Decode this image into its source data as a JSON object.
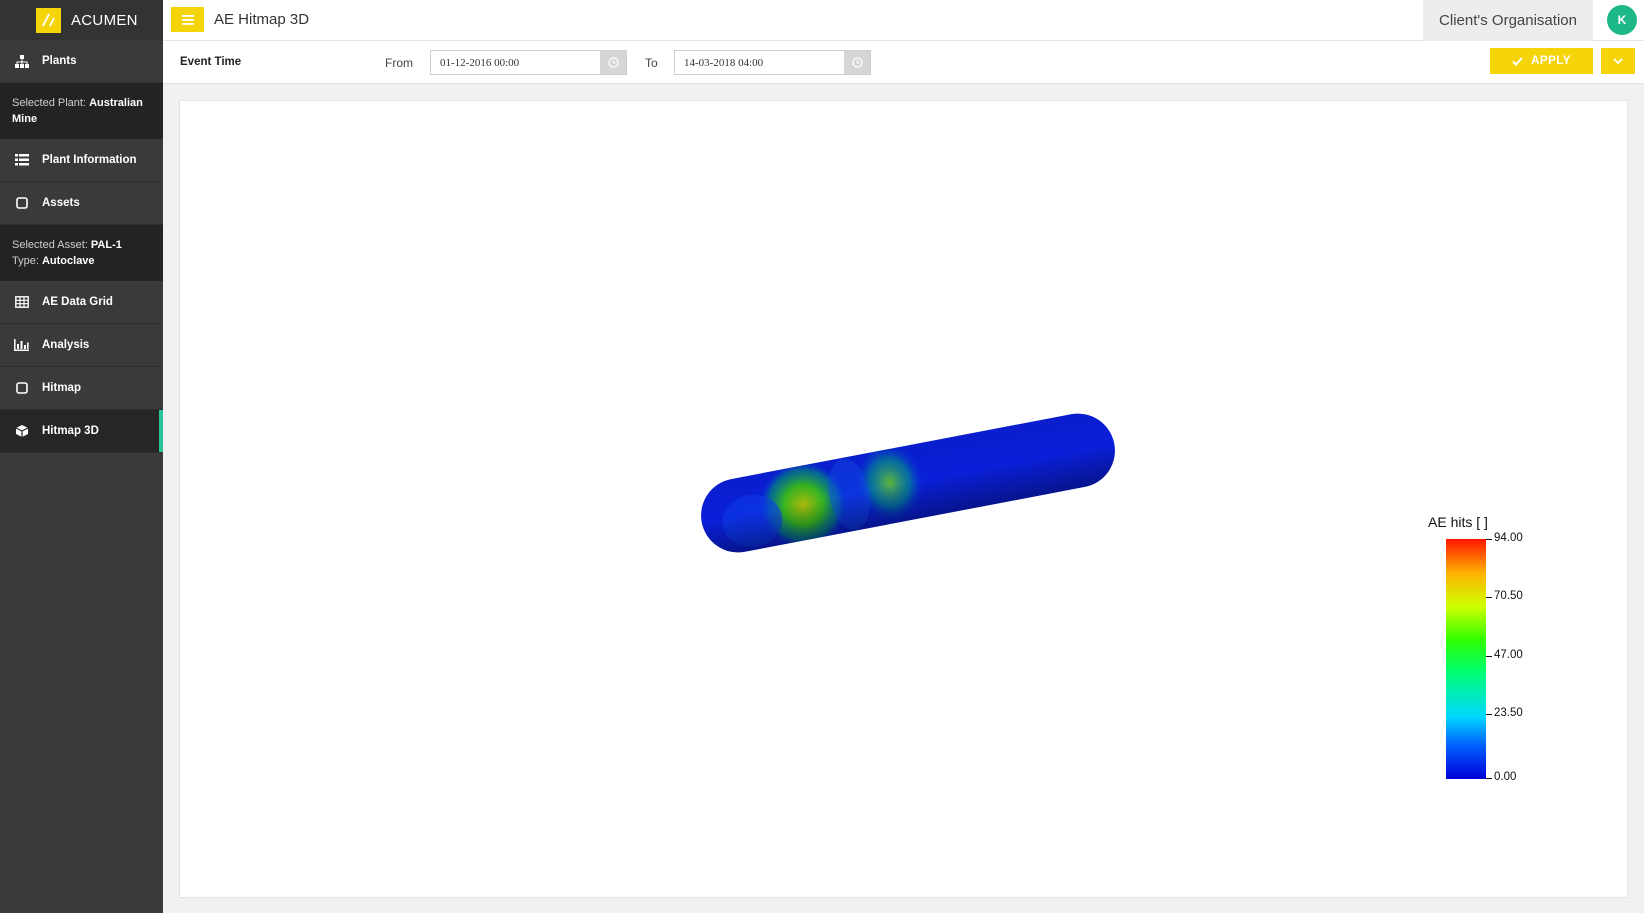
{
  "brand": {
    "name": "ACUMEN",
    "accent": "#f5d40a",
    "active_indicator": "#2bc49b"
  },
  "sidebar": {
    "items": [
      {
        "label": "Plants",
        "icon": "sitemap-icon"
      },
      {
        "label": "Plant Information",
        "icon": "list-icon"
      },
      {
        "label": "Assets",
        "icon": "square-icon"
      },
      {
        "label": "AE Data Grid",
        "icon": "table-icon"
      },
      {
        "label": "Analysis",
        "icon": "bar-chart-icon"
      },
      {
        "label": "Hitmap",
        "icon": "square-icon"
      },
      {
        "label": "Hitmap 3D",
        "icon": "cube-icon",
        "active": true
      }
    ],
    "selected_plant": {
      "prefix": "Selected Plant: ",
      "value": "Australian Mine"
    },
    "selected_asset": {
      "prefix": "Selected Asset: ",
      "value": "PAL-1",
      "type_prefix": "Type: ",
      "type_value": "Autoclave"
    }
  },
  "header": {
    "title": "AE Hitmap 3D",
    "organisation": "Client's Organisation",
    "avatar_initial": "K"
  },
  "filter": {
    "label": "Event Time",
    "from_label": "From",
    "from_value": "01-12-2016 00:00",
    "to_label": "To",
    "to_value": "14-03-2018 04:00",
    "apply_label": "APPLY"
  },
  "colorbar": {
    "title": "AE hits [  ]",
    "min": 0,
    "max": 94,
    "ticks": [
      "94.00",
      "70.50",
      "47.00",
      "23.50",
      "0.00"
    ]
  }
}
